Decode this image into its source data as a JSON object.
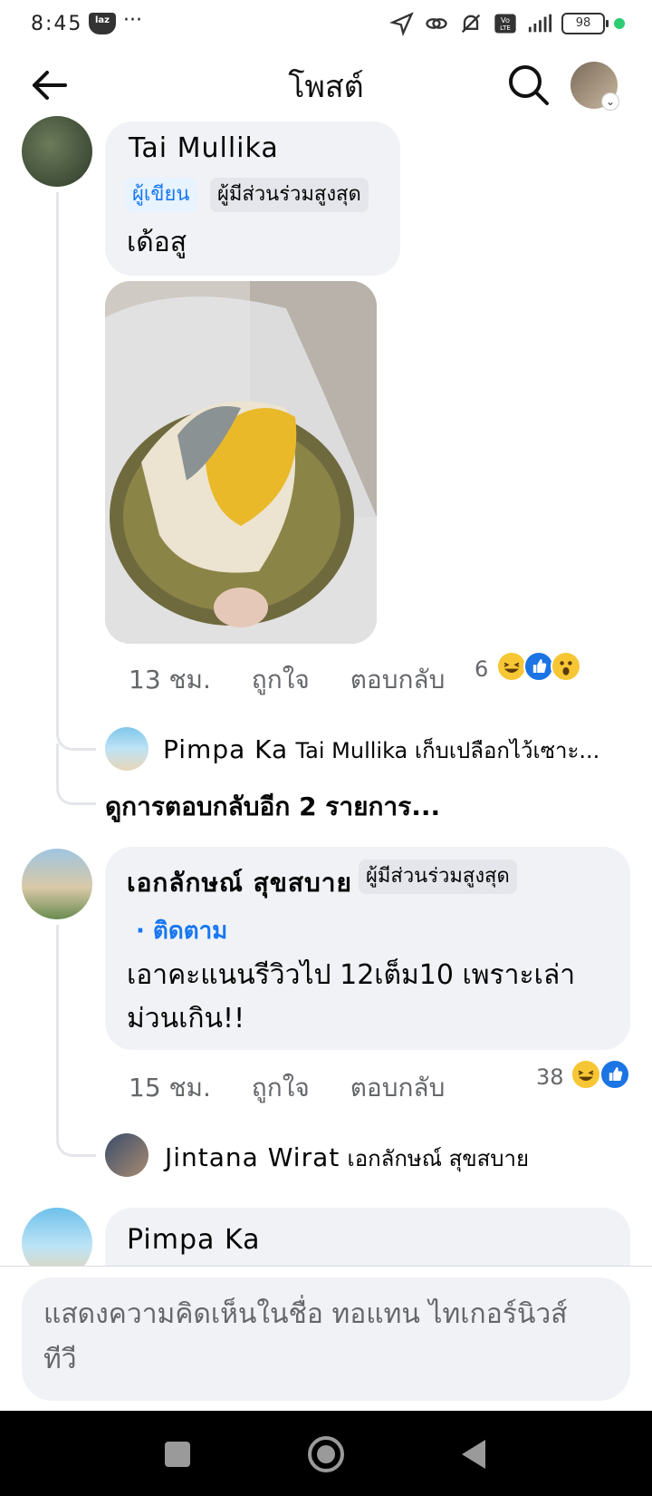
{
  "status_bar": {
    "time": "8:45",
    "laz_label": "laz",
    "more": "···",
    "battery": "98",
    "volte": "Vo LTE",
    "network": "4G"
  },
  "header": {
    "title": "โพสต์"
  },
  "comments": [
    {
      "name": "Tai Mullika",
      "badges": [
        "ผู้เขียน",
        "ผู้มีส่วนร่วมสูงสุด"
      ],
      "text": "เด้อสู",
      "time": "13 ชม.",
      "like": "ถูกใจ",
      "reply": "ตอบกลับ",
      "reaction_count": "6",
      "reactions": [
        "haha",
        "like",
        "wow"
      ],
      "reply_preview": {
        "name": "Pimpa Ka",
        "text": "Tai Mullika เก็บเปลือกไว้เซาะ..."
      },
      "more_replies": "ดูการตอบกลับอีก 2 รายการ..."
    },
    {
      "name": "เอกลักษณ์ สุขสบาย",
      "badges": [
        "ผู้มีส่วนร่วมสูงสุด"
      ],
      "follow": "· ติดตาม",
      "text_line1": "เอาคะแนนรีวิวไป 12เต็ม10 เพราะเล่า",
      "text_line2": "ม่วนเกิน!!",
      "time": "15 ชม.",
      "like": "ถูกใจ",
      "reply": "ตอบกลับ",
      "reaction_count": "38",
      "reactions": [
        "haha",
        "like"
      ],
      "reply_preview": {
        "name": "Jintana Wirat",
        "text": "เอกลักษณ์ สุขสบาย"
      }
    },
    {
      "name": "Pimpa Ka"
    }
  ],
  "composer": {
    "placeholder": "แสดงความคิดเห็นในชื่อ ทอแทน ไทเกอร์นิวส์ ทีวี"
  },
  "colors": {
    "accent": "#1877f2",
    "bubble": "#f0f2f5",
    "meta": "#65676b"
  }
}
